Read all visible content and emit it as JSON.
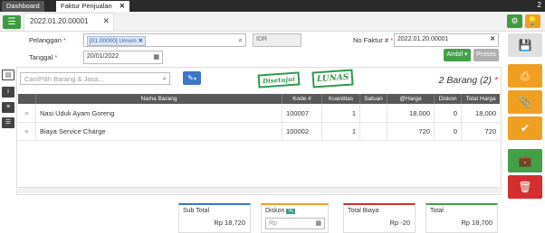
{
  "topbar": {
    "tabs": [
      "Dashboard",
      "Faktur Penjualan"
    ],
    "close": "✕",
    "counter": "2"
  },
  "doc": {
    "tab_label": "2022.01.20.00001",
    "close": "✕"
  },
  "form": {
    "pelanggan_label": "Pelanggan",
    "pelanggan_tag": "[01.00000] Umum",
    "currency": "IDR",
    "tanggal_label": "Tanggal",
    "tanggal_value": "20/01/2022",
    "faktur_label": "No Faktur #",
    "faktur_value": "2022.01.20.00001",
    "ambil_label": "Ambil",
    "proses_label": "Proses",
    "required": "*"
  },
  "items": {
    "search_placeholder": "Cari/Pilih Barang & Jasa...",
    "stamp_approved": "Disetujui",
    "stamp_paid": "LUNAS",
    "count_label": "2 Barang (2)",
    "headers": {
      "nama": "Nama Barang",
      "kode": "Kode #",
      "qty": "Kuantitas",
      "satuan": "Satuan",
      "harga": "@Harga",
      "diskon": "Diskon",
      "total": "Total Harga"
    },
    "rows": [
      {
        "nama": "Nasi Uduk Ayam Goreng",
        "kode": "100007",
        "qty": "1",
        "satuan": "",
        "harga": "18,000",
        "diskon": "0",
        "total": "18,000"
      },
      {
        "nama": "Biaya Service Charge",
        "kode": "100002",
        "qty": "1",
        "satuan": "",
        "harga": "720",
        "diskon": "0",
        "total": "720"
      }
    ]
  },
  "totals": {
    "subtotal_label": "Sub Total",
    "subtotal_value": "Rp 18,720",
    "diskon_label": "Diskon",
    "diskon_badge": "%",
    "diskon_placeholder": "Rp",
    "biaya_label": "Total Biaya",
    "biaya_value": "Rp -20",
    "total_label": "Total",
    "total_value": "Rp 18,700"
  },
  "colors": {
    "green": "#3f9b3f",
    "orange": "#f0a020",
    "red": "#d32f2f",
    "blue": "#3a78c8"
  }
}
